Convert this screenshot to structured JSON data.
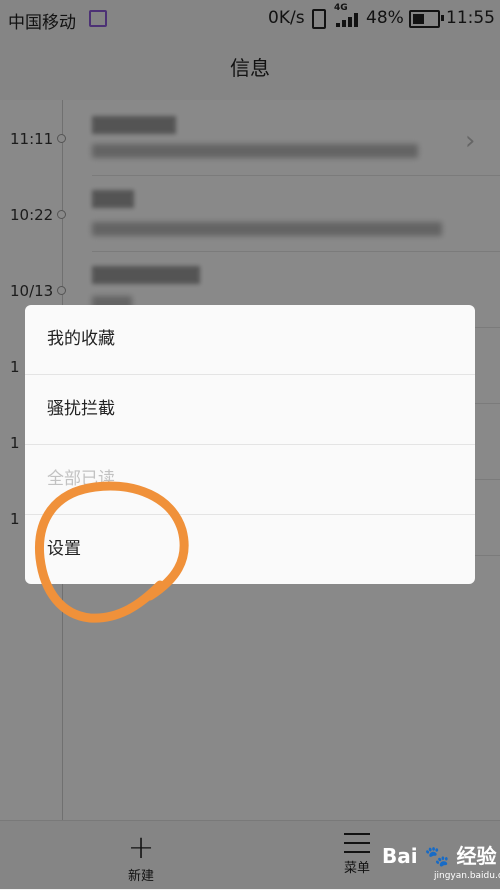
{
  "status_bar": {
    "carrier": "中国移动",
    "net_speed": "0K/s",
    "network_type": "4G",
    "battery": "48%",
    "time": "11:55"
  },
  "title": "信息",
  "conversations": [
    {
      "time": "11:11"
    },
    {
      "time": "10:22"
    },
    {
      "time": "10/13"
    },
    {
      "time": "1"
    },
    {
      "time": "1"
    },
    {
      "time": "1"
    }
  ],
  "menu": {
    "items": [
      {
        "label": "我的收藏",
        "enabled": true
      },
      {
        "label": "骚扰拦截",
        "enabled": true
      },
      {
        "label": "全部已读",
        "enabled": false
      },
      {
        "label": "设置",
        "enabled": true
      }
    ]
  },
  "bottom_bar": {
    "new_label": "新建",
    "menu_label": "菜单"
  },
  "watermark": {
    "brand": "Bai",
    "suffix": "经验",
    "url": "jingyan.baidu.com"
  },
  "colors": {
    "annotation": "#f0913a",
    "overlay": "rgba(0,0,0,0.45)",
    "text": "#222222"
  }
}
